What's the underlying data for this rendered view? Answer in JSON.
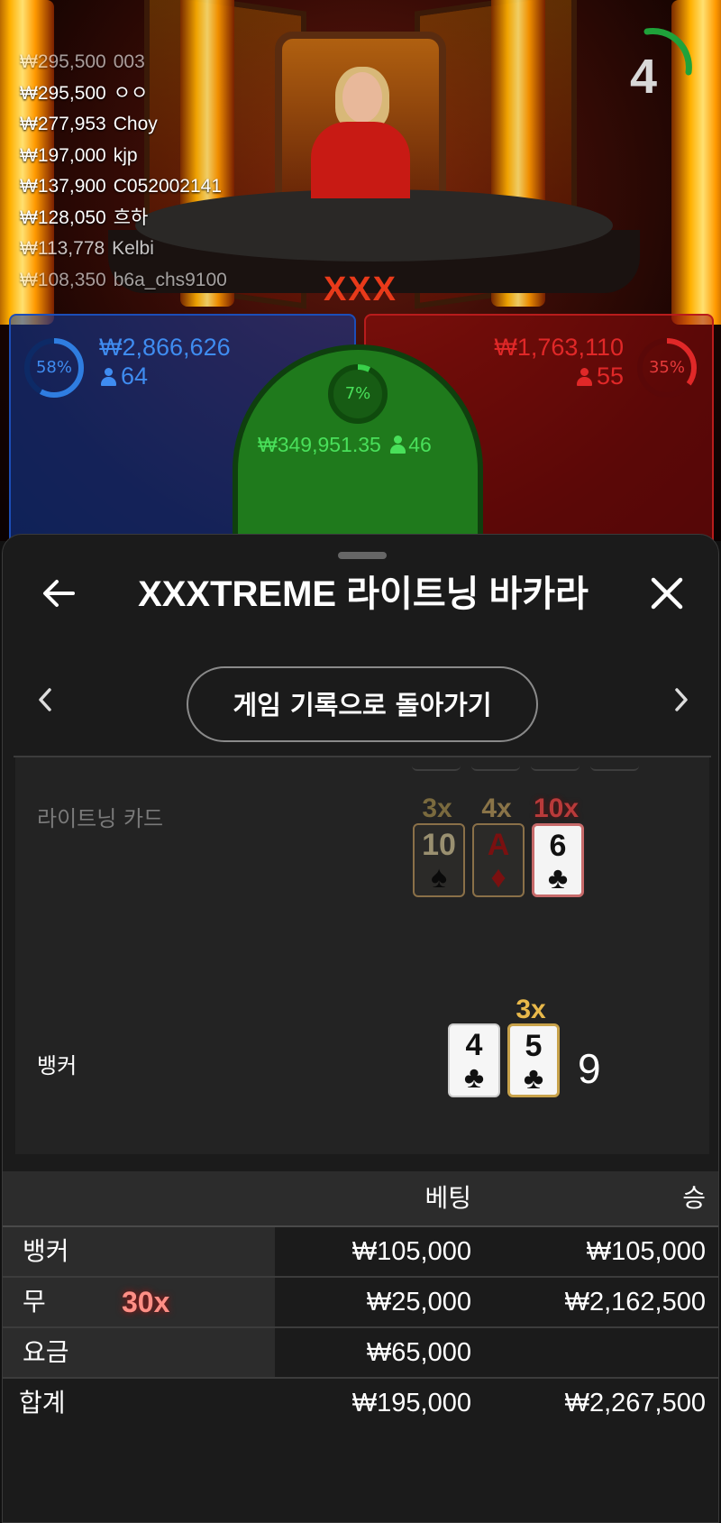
{
  "leaderboard": [
    {
      "amount": "₩295,500",
      "name": "003"
    },
    {
      "amount": "₩295,500",
      "name": "ㅇㅇ"
    },
    {
      "amount": "₩277,953",
      "name": "Choy"
    },
    {
      "amount": "₩197,000",
      "name": "kjp"
    },
    {
      "amount": "₩137,900",
      "name": "C052002141"
    },
    {
      "amount": "₩128,050",
      "name": "흐하"
    },
    {
      "amount": "₩113,778",
      "name": "Kelbi"
    },
    {
      "amount": "₩108,350",
      "name": "b6a_chs9100"
    }
  ],
  "timer": {
    "value": "4"
  },
  "scene_logo": "XXX",
  "bet_zones": {
    "player": {
      "percent": "58%",
      "percent_value": 58,
      "amount": "₩2,866,626",
      "players": "64",
      "color": "#2f7de0"
    },
    "tie": {
      "percent": "7%",
      "percent_value": 7,
      "amount": "₩349,951.35",
      "players": "46",
      "color": "#39d14a"
    },
    "banker": {
      "percent": "35%",
      "percent_value": 35,
      "amount": "₩1,763,110",
      "players": "55",
      "color": "#e02828"
    }
  },
  "sheet": {
    "title": "XXXTREME 라이트닝 바카라",
    "back_to_history": "게임 기록으로 돌아가기"
  },
  "lightning": {
    "label": "라이트닝 카드",
    "cards": [
      {
        "multiplier": "3x",
        "rank": "10",
        "suit": "♠",
        "suit_color": "black",
        "multiplier_color": "#7a6a3e",
        "style": "dim"
      },
      {
        "multiplier": "4x",
        "rank": "A",
        "suit": "♦",
        "suit_color": "red",
        "multiplier_color": "#8a7448",
        "style": "dim red"
      },
      {
        "multiplier": "10x",
        "rank": "6",
        "suit": "♣",
        "suit_color": "black",
        "multiplier_color": "#b83a3a",
        "style": "lit"
      }
    ]
  },
  "banker_hand": {
    "label": "뱅커",
    "cards": [
      {
        "rank": "4",
        "suit": "♣",
        "multiplier": ""
      },
      {
        "rank": "5",
        "suit": "♣",
        "multiplier": "3x"
      }
    ],
    "score": "9"
  },
  "results_table": {
    "headers": {
      "bet": "베팅",
      "win": "승"
    },
    "rows": [
      {
        "name": "뱅커",
        "multiplier": "",
        "bet": "₩105,000",
        "win": "₩105,000"
      },
      {
        "name": "무",
        "multiplier": "30x",
        "bet": "₩25,000",
        "win": "₩2,162,500"
      },
      {
        "name": "요금",
        "multiplier": "",
        "bet": "₩65,000",
        "win": ""
      }
    ],
    "total": {
      "name": "합계",
      "bet": "₩195,000",
      "win": "₩2,267,500"
    }
  }
}
